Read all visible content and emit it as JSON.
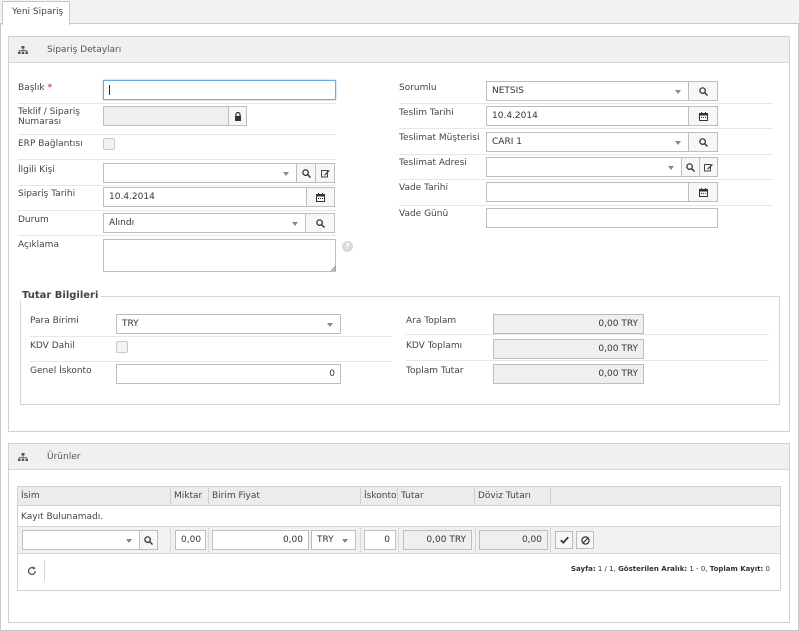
{
  "tab": {
    "label": "Yeni Sipariş"
  },
  "order_panel": {
    "title": "Sipariş Detayları",
    "left": {
      "baslik_label": "Başlık",
      "required_mark": "*",
      "baslik_value": "",
      "teklif_label": "Teklif / Sipariş Numarası",
      "teklif_value": "",
      "erp_label": "ERP Bağlantısı",
      "ilgili_label": "İlgili Kişi",
      "ilgili_value": "",
      "siparis_tarihi_label": "Sipariş Tarihi",
      "siparis_tarihi_value": "10.4.2014",
      "durum_label": "Durum",
      "durum_value": "Alındı",
      "aciklama_label": "Açıklama",
      "aciklama_value": "",
      "help_glyph": "?"
    },
    "right": {
      "sorumlu_label": "Sorumlu",
      "sorumlu_value": "NETSIS",
      "teslim_tarihi_label": "Teslim Tarihi",
      "teslim_tarihi_value": "10.4.2014",
      "teslimat_musterisi_label": "Teslimat Müşterisi",
      "teslimat_musterisi_value": "CARI 1",
      "teslimat_adresi_label": "Teslimat Adresi",
      "teslimat_adresi_value": "",
      "vade_tarihi_label": "Vade Tarihi",
      "vade_tarihi_value": "",
      "vade_gunu_label": "Vade Günü",
      "vade_gunu_value": ""
    },
    "totals": {
      "legend": "Tutar Bilgileri",
      "para_birimi_label": "Para Birimi",
      "para_birimi_value": "TRY",
      "kdv_dahil_label": "KDV Dahil",
      "genel_iskonto_label": "Genel İskonto",
      "genel_iskonto_value": "0",
      "ara_toplam_label": "Ara Toplam",
      "ara_toplam_value": "0,00 TRY",
      "kdv_toplami_label": "KDV Toplamı",
      "kdv_toplami_value": "0,00 TRY",
      "toplam_tutar_label": "Toplam Tutar",
      "toplam_tutar_value": "0,00 TRY"
    }
  },
  "products_panel": {
    "title": "Ürünler",
    "columns": [
      "İsim",
      "Miktar",
      "Birim Fiyat",
      "İskonto",
      "Tutar",
      "Döviz Tutarı"
    ],
    "empty_text": "Kayıt Bulunamadı.",
    "edit_row": {
      "isim": "",
      "miktar": "0,00",
      "birim_fiyat": "0,00",
      "currency": "TRY",
      "iskonto": "0",
      "tutar": "0,00 TRY",
      "doviz_tutari": "0,00"
    },
    "footer": {
      "sayfa_label": "Sayfa:",
      "sayfa_value": "1 / 1,",
      "aralik_label": "Gösterilen Aralık:",
      "aralik_value": "1 - 0,",
      "toplam_label": "Toplam Kayıt:",
      "toplam_value": "0"
    }
  }
}
